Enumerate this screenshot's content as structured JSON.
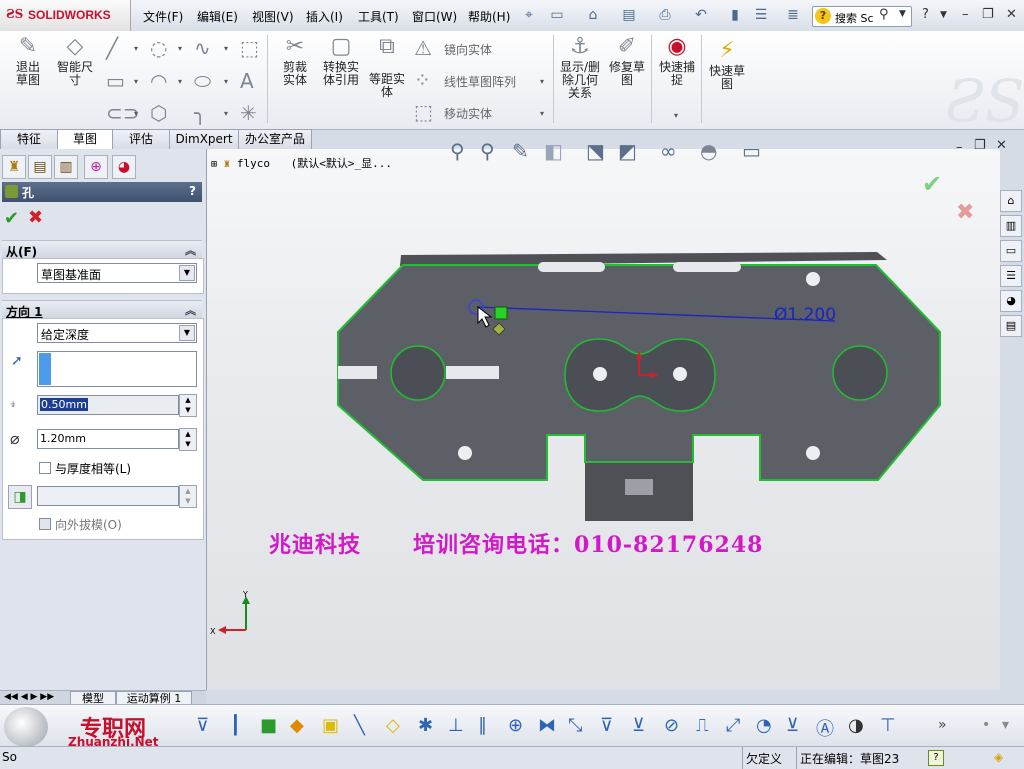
{
  "app": {
    "brand": "SOLIDWORKS"
  },
  "menu": [
    "文件(F)",
    "编辑(E)",
    "视图(V)",
    "插入(I)",
    "工具(T)",
    "窗口(W)",
    "帮助(H)"
  ],
  "search": {
    "label": "搜索 Sc"
  },
  "command_manager": {
    "exit_sketch": "退出草图",
    "smart_dim": "智能尺寸",
    "trim": "剪裁实体",
    "convert": "转换实体引用",
    "offset": "等距实体",
    "mirror": "镜向实体",
    "linear_pattern": "线性草图阵列",
    "move": "移动实体",
    "show_relations": "显示/删除几何关系",
    "repair": "修复草图",
    "quick_snaps": "快速捕捉",
    "rapid_sketch": "快速草图"
  },
  "tabs": [
    "特征",
    "草图",
    "评估",
    "DimXpert",
    "办公室产品"
  ],
  "active_tab": "草图",
  "panel": {
    "title": "孔",
    "help": "?",
    "from_header": "从(F)",
    "from_value": "草图基准面",
    "dir_header": "方向 1",
    "end_condition": "给定深度",
    "depth_value": "0.50mm",
    "diameter_value": "1.20mm",
    "equal_thickness_label": "与厚度相等(L)",
    "draft_outward_label": "向外拔模(O)"
  },
  "viewport": {
    "tree_label": "flyco",
    "config_label": "(默认<默认>_显...",
    "dimension_label": "Ø1.200",
    "watermark": "兆迪科技      培训咨询电话：010-82176248",
    "axis_y": "Y",
    "axis_x": "X"
  },
  "bottom_tabs": [
    "模型",
    "运动算例 1"
  ],
  "bottom_watermark": {
    "cn": "专职网",
    "url": "Zhuanzhi.Net"
  },
  "status": {
    "left": "So",
    "underdefined": "欠定义",
    "editing": "正在编辑：草图23",
    "help": "?"
  },
  "colors": {
    "sketch_green": "#1fbf2f",
    "dimension_blue": "#1a22c8",
    "part_fill": "#5d5f66",
    "watermark_magenta": "#d218c8",
    "panel_header": "#4a5d7c"
  }
}
